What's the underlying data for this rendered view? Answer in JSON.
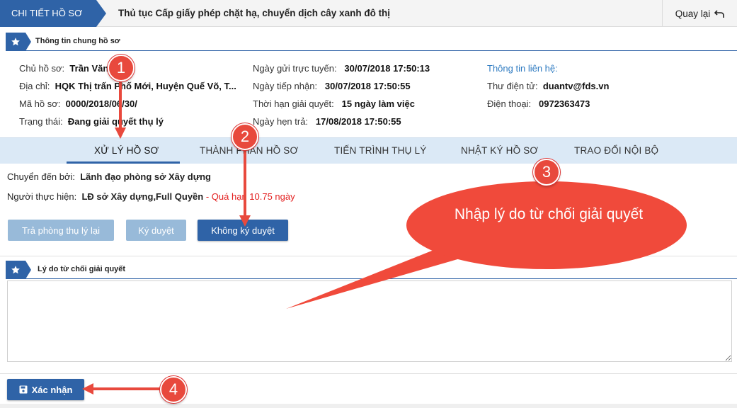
{
  "header": {
    "breadcrumb": "CHI TIẾT HỒ SƠ",
    "title": "Thủ tục Cấp giấy phép chặt hạ, chuyển dịch cây xanh đô thị",
    "back_label": "Quay lại"
  },
  "general_section": {
    "title": "Thông tin chung hồ sơ",
    "col1": [
      {
        "label": "Chủ hồ sơ:",
        "value": "Trần Văn ...n"
      },
      {
        "label": "Địa chỉ:",
        "value": "HQK Thị trấn Phố Mới, Huyện Quế Võ, T..."
      },
      {
        "label": "Mã hồ sơ:",
        "value": "0000/2018/06/30/"
      },
      {
        "label": "Trạng thái:",
        "value": "Đang giải quyết thụ lý"
      }
    ],
    "col2": [
      {
        "label": "Ngày gửi trực tuyến:",
        "value": "30/07/2018 17:50:13"
      },
      {
        "label": "Ngày tiếp nhận:",
        "value": "30/07/2018 17:50:55"
      },
      {
        "label": "Thời hạn giải quyết:",
        "value": "15 ngày làm việc"
      },
      {
        "label": "Ngày hẹn trả:",
        "value": "17/08/2018 17:50:55"
      }
    ],
    "col3": {
      "contact_heading": "Thông tin liên hệ:",
      "email_label": "Thư điện tử:",
      "email_value": "duantv@fds.vn",
      "phone_label": "Điện thoại:",
      "phone_value": "0972363473"
    }
  },
  "tabs": [
    {
      "label": "XỬ LÝ HỒ SƠ",
      "active": true
    },
    {
      "label": "THÀNH PHẦN HỒ SƠ",
      "active": false
    },
    {
      "label": "TIẾN TRÌNH THỤ LÝ",
      "active": false
    },
    {
      "label": "NHẬT KÝ HỒ SƠ",
      "active": false
    },
    {
      "label": "TRAO ĐỔI NỘI BỘ",
      "active": false
    }
  ],
  "process": {
    "forwarded_by_label": "Chuyển đến bởi:",
    "forwarded_by_value": "Lãnh đạo phòng sở Xây dựng",
    "executor_label": "Người thực hiện:",
    "executor_value": "LĐ sở Xây dựng,Full Quyền",
    "overdue_text": "- Quá hạn 10.75 ngày",
    "buttons": {
      "return": "Trả phòng thụ lý lại",
      "approve": "Ký duyệt",
      "reject": "Không ký duyệt"
    }
  },
  "reason_section": {
    "title": "Lý do từ chối giải quyết",
    "textarea_value": ""
  },
  "confirm_label": "Xác nhận",
  "annotations": {
    "step1": "1",
    "step2": "2",
    "step3": "3",
    "step4": "4",
    "callout": "Nhập lý do từ chối giải quyết",
    "arrow_color": "#e8493d"
  },
  "colors": {
    "primary": "#2f63a7",
    "disabled_button": "#98bad9",
    "tab_bar": "#dbe9f6",
    "overdue": "#e32020",
    "link": "#2f7bc1"
  }
}
